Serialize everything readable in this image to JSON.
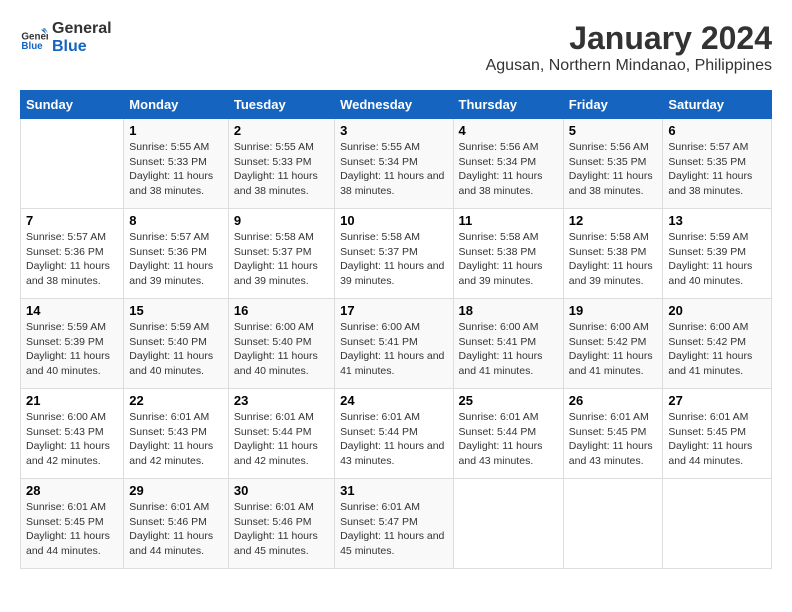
{
  "logo": {
    "line1": "General",
    "line2": "Blue"
  },
  "title": "January 2024",
  "subtitle": "Agusan, Northern Mindanao, Philippines",
  "days_of_week": [
    "Sunday",
    "Monday",
    "Tuesday",
    "Wednesday",
    "Thursday",
    "Friday",
    "Saturday"
  ],
  "weeks": [
    [
      {
        "day": "",
        "sunrise": "",
        "sunset": "",
        "daylight": ""
      },
      {
        "day": "1",
        "sunrise": "5:55 AM",
        "sunset": "5:33 PM",
        "daylight": "11 hours and 38 minutes."
      },
      {
        "day": "2",
        "sunrise": "5:55 AM",
        "sunset": "5:33 PM",
        "daylight": "11 hours and 38 minutes."
      },
      {
        "day": "3",
        "sunrise": "5:55 AM",
        "sunset": "5:34 PM",
        "daylight": "11 hours and 38 minutes."
      },
      {
        "day": "4",
        "sunrise": "5:56 AM",
        "sunset": "5:34 PM",
        "daylight": "11 hours and 38 minutes."
      },
      {
        "day": "5",
        "sunrise": "5:56 AM",
        "sunset": "5:35 PM",
        "daylight": "11 hours and 38 minutes."
      },
      {
        "day": "6",
        "sunrise": "5:57 AM",
        "sunset": "5:35 PM",
        "daylight": "11 hours and 38 minutes."
      }
    ],
    [
      {
        "day": "7",
        "sunrise": "5:57 AM",
        "sunset": "5:36 PM",
        "daylight": "11 hours and 38 minutes."
      },
      {
        "day": "8",
        "sunrise": "5:57 AM",
        "sunset": "5:36 PM",
        "daylight": "11 hours and 39 minutes."
      },
      {
        "day": "9",
        "sunrise": "5:58 AM",
        "sunset": "5:37 PM",
        "daylight": "11 hours and 39 minutes."
      },
      {
        "day": "10",
        "sunrise": "5:58 AM",
        "sunset": "5:37 PM",
        "daylight": "11 hours and 39 minutes."
      },
      {
        "day": "11",
        "sunrise": "5:58 AM",
        "sunset": "5:38 PM",
        "daylight": "11 hours and 39 minutes."
      },
      {
        "day": "12",
        "sunrise": "5:58 AM",
        "sunset": "5:38 PM",
        "daylight": "11 hours and 39 minutes."
      },
      {
        "day": "13",
        "sunrise": "5:59 AM",
        "sunset": "5:39 PM",
        "daylight": "11 hours and 40 minutes."
      }
    ],
    [
      {
        "day": "14",
        "sunrise": "5:59 AM",
        "sunset": "5:39 PM",
        "daylight": "11 hours and 40 minutes."
      },
      {
        "day": "15",
        "sunrise": "5:59 AM",
        "sunset": "5:40 PM",
        "daylight": "11 hours and 40 minutes."
      },
      {
        "day": "16",
        "sunrise": "6:00 AM",
        "sunset": "5:40 PM",
        "daylight": "11 hours and 40 minutes."
      },
      {
        "day": "17",
        "sunrise": "6:00 AM",
        "sunset": "5:41 PM",
        "daylight": "11 hours and 41 minutes."
      },
      {
        "day": "18",
        "sunrise": "6:00 AM",
        "sunset": "5:41 PM",
        "daylight": "11 hours and 41 minutes."
      },
      {
        "day": "19",
        "sunrise": "6:00 AM",
        "sunset": "5:42 PM",
        "daylight": "11 hours and 41 minutes."
      },
      {
        "day": "20",
        "sunrise": "6:00 AM",
        "sunset": "5:42 PM",
        "daylight": "11 hours and 41 minutes."
      }
    ],
    [
      {
        "day": "21",
        "sunrise": "6:00 AM",
        "sunset": "5:43 PM",
        "daylight": "11 hours and 42 minutes."
      },
      {
        "day": "22",
        "sunrise": "6:01 AM",
        "sunset": "5:43 PM",
        "daylight": "11 hours and 42 minutes."
      },
      {
        "day": "23",
        "sunrise": "6:01 AM",
        "sunset": "5:44 PM",
        "daylight": "11 hours and 42 minutes."
      },
      {
        "day": "24",
        "sunrise": "6:01 AM",
        "sunset": "5:44 PM",
        "daylight": "11 hours and 43 minutes."
      },
      {
        "day": "25",
        "sunrise": "6:01 AM",
        "sunset": "5:44 PM",
        "daylight": "11 hours and 43 minutes."
      },
      {
        "day": "26",
        "sunrise": "6:01 AM",
        "sunset": "5:45 PM",
        "daylight": "11 hours and 43 minutes."
      },
      {
        "day": "27",
        "sunrise": "6:01 AM",
        "sunset": "5:45 PM",
        "daylight": "11 hours and 44 minutes."
      }
    ],
    [
      {
        "day": "28",
        "sunrise": "6:01 AM",
        "sunset": "5:45 PM",
        "daylight": "11 hours and 44 minutes."
      },
      {
        "day": "29",
        "sunrise": "6:01 AM",
        "sunset": "5:46 PM",
        "daylight": "11 hours and 44 minutes."
      },
      {
        "day": "30",
        "sunrise": "6:01 AM",
        "sunset": "5:46 PM",
        "daylight": "11 hours and 45 minutes."
      },
      {
        "day": "31",
        "sunrise": "6:01 AM",
        "sunset": "5:47 PM",
        "daylight": "11 hours and 45 minutes."
      },
      {
        "day": "",
        "sunrise": "",
        "sunset": "",
        "daylight": ""
      },
      {
        "day": "",
        "sunrise": "",
        "sunset": "",
        "daylight": ""
      },
      {
        "day": "",
        "sunrise": "",
        "sunset": "",
        "daylight": ""
      }
    ]
  ]
}
